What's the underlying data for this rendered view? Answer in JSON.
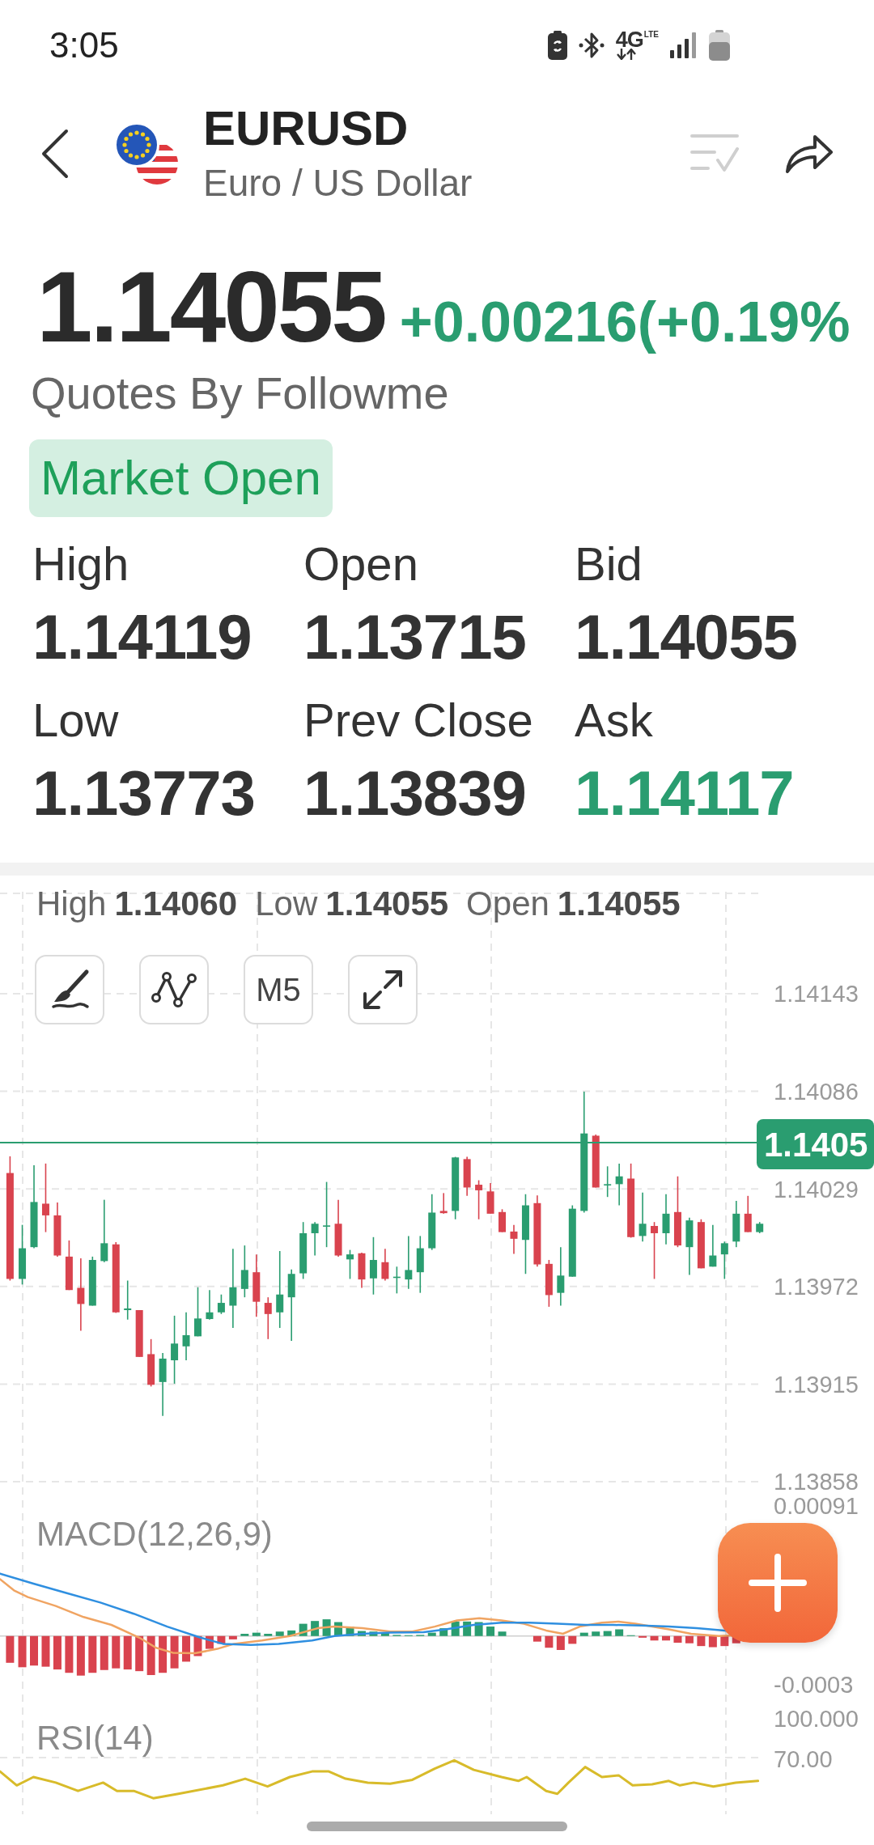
{
  "status_bar": {
    "time": "3:05",
    "network": "4G",
    "network_sub": "LTE"
  },
  "header": {
    "symbol": "EURUSD",
    "name": "Euro / US Dollar"
  },
  "quote": {
    "price": "1.14055",
    "change": "+0.00216(+0.19%",
    "rising": true,
    "source": "Quotes By Followme"
  },
  "market_status": {
    "label": "Market Open",
    "open": true
  },
  "stats": [
    {
      "label": "High",
      "value": "1.14119",
      "color": "#333333"
    },
    {
      "label": "Open",
      "value": "1.13715",
      "color": "#333333"
    },
    {
      "label": "Bid",
      "value": "1.14055",
      "color": "#333333"
    },
    {
      "label": "Low",
      "value": "1.13773",
      "color": "#333333"
    },
    {
      "label": "Prev Close",
      "value": "1.13839",
      "color": "#333333"
    },
    {
      "label": "Ask",
      "value": "1.14117",
      "color": "#2a9d70"
    }
  ],
  "chart": {
    "ohlc": [
      {
        "label": "High",
        "value": "1.14060"
      },
      {
        "label": "Low",
        "value": "1.14055"
      },
      {
        "label": "Open",
        "value": "1.14055"
      }
    ],
    "tools": [
      {
        "kind": "draw"
      },
      {
        "kind": "indicator"
      },
      {
        "kind": "period",
        "label": "M5"
      },
      {
        "kind": "fullscreen"
      }
    ],
    "price_axis": [
      "1.14143",
      "1.14086",
      "1.14029",
      "1.13972",
      "1.13915",
      "1.13858"
    ],
    "last_price": "1.1405",
    "macd": {
      "title": "MACD(12,26,9)",
      "axis": [
        "0.00091",
        "-0.0003"
      ]
    },
    "rsi": {
      "title": "RSI(14)",
      "axis": [
        "100.000",
        "70.00"
      ]
    }
  }
}
